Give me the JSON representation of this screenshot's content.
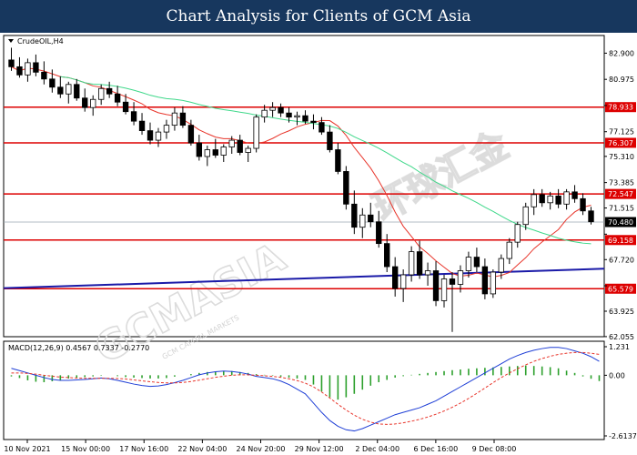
{
  "header": {
    "title": "Chart Analysis for Clients of GCM Asia"
  },
  "watermark": {
    "brand": "GCMASIA",
    "chinese": "环球汇金",
    "tagline": "GCM CAPITAL MARKETS"
  },
  "colors": {
    "background": "#ffffff",
    "header_bg": "#17375e",
    "bull_candle": "#ffffff",
    "bear_candle": "#000000",
    "fast_ma": "#e8352b",
    "slow_ma": "#3fd88a",
    "trendline": "#1a1aa8",
    "hline": "#dd0000",
    "macd_hist": "#2ca02c",
    "macd_line": "#1f3fd6",
    "macd_signal": "#e8352b",
    "price_tag": "#000000"
  },
  "chart_data": [
    {
      "type": "candlestick",
      "symbol_label": "CrudeOIL,H4",
      "ylim": [
        62.05,
        84.2
      ],
      "y_ticks": [
        "82.900",
        "80.975",
        "79.050",
        "77.125",
        "75.310",
        "73.385",
        "71.515",
        "69.590",
        "67.720",
        "65.795",
        "63.925",
        "62.055"
      ],
      "x_ticks": [
        "10 Nov 2021",
        "15 Nov 00:00",
        "17 Nov 16:00",
        "22 Nov 04:00",
        "24 Nov 20:00",
        "29 Nov 12:00",
        "2 Dec 04:00",
        "6 Dec 16:00",
        "9 Dec 08:00"
      ],
      "current_price": "70.480",
      "horizontal_levels": [
        "78.933",
        "76.307",
        "72.547",
        "69.158",
        "65.579"
      ],
      "candles": [
        [
          82.4,
          83.3,
          81.6,
          81.9
        ],
        [
          81.9,
          82.6,
          81.1,
          81.3
        ],
        [
          81.3,
          82.5,
          80.8,
          82.2
        ],
        [
          82.2,
          82.8,
          81.2,
          81.5
        ],
        [
          81.5,
          82.3,
          80.6,
          81.0
        ],
        [
          81.0,
          81.7,
          80.0,
          80.4
        ],
        [
          80.4,
          81.2,
          79.6,
          79.9
        ],
        [
          79.9,
          80.8,
          79.2,
          80.6
        ],
        [
          80.6,
          81.0,
          79.4,
          79.6
        ],
        [
          79.6,
          80.3,
          78.6,
          78.9
        ],
        [
          78.9,
          79.8,
          78.3,
          79.5
        ],
        [
          79.5,
          80.6,
          79.1,
          80.3
        ],
        [
          80.3,
          80.8,
          79.6,
          79.9
        ],
        [
          79.9,
          80.5,
          79.0,
          79.3
        ],
        [
          79.3,
          79.9,
          78.4,
          78.6
        ],
        [
          78.6,
          79.3,
          77.6,
          77.9
        ],
        [
          77.9,
          78.5,
          76.9,
          77.2
        ],
        [
          77.2,
          77.8,
          76.2,
          76.5
        ],
        [
          76.5,
          77.4,
          76.0,
          77.1
        ],
        [
          77.1,
          78.0,
          76.6,
          77.6
        ],
        [
          77.6,
          78.9,
          77.2,
          78.5
        ],
        [
          78.5,
          79.0,
          77.4,
          77.6
        ],
        [
          77.6,
          78.0,
          76.1,
          76.3
        ],
        [
          76.3,
          76.9,
          75.0,
          75.3
        ],
        [
          75.3,
          76.1,
          74.6,
          75.8
        ],
        [
          75.8,
          76.6,
          75.2,
          75.4
        ],
        [
          75.4,
          76.2,
          74.9,
          76.0
        ],
        [
          76.0,
          76.8,
          75.5,
          76.5
        ],
        [
          76.5,
          76.9,
          75.4,
          75.6
        ],
        [
          75.6,
          76.1,
          74.9,
          75.9
        ],
        [
          75.9,
          78.4,
          75.6,
          78.2
        ],
        [
          78.2,
          79.1,
          77.8,
          78.7
        ],
        [
          78.7,
          79.3,
          78.2,
          78.9
        ],
        [
          78.9,
          79.2,
          78.2,
          78.5
        ],
        [
          78.5,
          78.9,
          77.8,
          78.2
        ],
        [
          78.2,
          78.6,
          77.6,
          78.3
        ],
        [
          78.3,
          78.7,
          77.7,
          77.9
        ],
        [
          77.9,
          78.4,
          77.3,
          77.8
        ],
        [
          77.8,
          78.2,
          76.9,
          77.1
        ],
        [
          77.1,
          77.6,
          75.6,
          75.8
        ],
        [
          75.8,
          76.3,
          74.0,
          74.2
        ],
        [
          74.2,
          74.6,
          71.4,
          71.8
        ],
        [
          71.8,
          72.8,
          69.6,
          70.1
        ],
        [
          70.1,
          71.5,
          69.3,
          71.0
        ],
        [
          71.0,
          71.9,
          70.1,
          70.5
        ],
        [
          70.5,
          71.3,
          68.6,
          68.9
        ],
        [
          68.9,
          69.6,
          66.8,
          67.2
        ],
        [
          67.2,
          67.9,
          65.0,
          65.6
        ],
        [
          65.6,
          67.0,
          64.6,
          66.6
        ],
        [
          66.6,
          68.7,
          66.1,
          68.3
        ],
        [
          68.3,
          69.1,
          66.3,
          66.6
        ],
        [
          66.6,
          67.5,
          65.8,
          66.9
        ],
        [
          66.9,
          67.6,
          64.3,
          64.7
        ],
        [
          64.7,
          66.6,
          64.2,
          66.3
        ],
        [
          66.3,
          66.8,
          62.4,
          65.9
        ],
        [
          65.9,
          67.3,
          65.3,
          66.9
        ],
        [
          66.9,
          68.3,
          66.4,
          67.9
        ],
        [
          67.9,
          68.6,
          66.8,
          67.2
        ],
        [
          67.2,
          67.8,
          64.8,
          65.2
        ],
        [
          65.2,
          67.0,
          64.9,
          66.8
        ],
        [
          66.8,
          68.1,
          66.3,
          67.8
        ],
        [
          67.8,
          69.3,
          67.4,
          69.0
        ],
        [
          69.0,
          70.5,
          68.6,
          70.3
        ],
        [
          70.3,
          71.9,
          69.9,
          71.6
        ],
        [
          71.6,
          72.9,
          71.0,
          72.5
        ],
        [
          72.5,
          72.9,
          71.6,
          71.9
        ],
        [
          71.9,
          72.7,
          71.4,
          72.4
        ],
        [
          72.4,
          72.9,
          71.5,
          71.8
        ],
        [
          71.8,
          72.9,
          71.4,
          72.7
        ],
        [
          72.7,
          73.2,
          71.9,
          72.2
        ],
        [
          72.2,
          72.6,
          71.0,
          71.3
        ],
        [
          71.3,
          71.6,
          70.3,
          70.5
        ]
      ]
    },
    {
      "type": "macd",
      "label": "MACD(12,26,9) 0.4567 0.7337 -0.2770",
      "y_ticks": [
        "1.231",
        "0.00",
        "-2.6137"
      ],
      "ylim": [
        -2.6137,
        1.231
      ],
      "histogram": [
        -0.05,
        -0.12,
        -0.22,
        -0.28,
        -0.3,
        -0.26,
        -0.2,
        -0.14,
        -0.1,
        -0.08,
        -0.05,
        -0.02,
        0.0,
        -0.04,
        -0.08,
        -0.1,
        -0.12,
        -0.14,
        -0.14,
        -0.12,
        -0.06,
        0.0,
        0.05,
        0.1,
        0.14,
        0.17,
        0.19,
        0.18,
        0.14,
        0.1,
        0.05,
        0.02,
        -0.02,
        -0.06,
        -0.1,
        -0.14,
        -0.2,
        -0.4,
        -0.7,
        -0.95,
        -1.05,
        -0.95,
        -0.8,
        -0.62,
        -0.45,
        -0.3,
        -0.2,
        -0.1,
        -0.04,
        0.02,
        0.06,
        0.1,
        0.14,
        0.18,
        0.22,
        0.25,
        0.28,
        0.3,
        0.32,
        0.34,
        0.36,
        0.38,
        0.4,
        0.42,
        0.4,
        0.38,
        0.35,
        0.3,
        0.2,
        0.1,
        -0.05,
        -0.15,
        -0.25
      ],
      "macd_line": [
        0.3,
        0.2,
        0.1,
        0.0,
        -0.1,
        -0.18,
        -0.22,
        -0.22,
        -0.2,
        -0.18,
        -0.15,
        -0.12,
        -0.15,
        -0.22,
        -0.3,
        -0.38,
        -0.44,
        -0.48,
        -0.46,
        -0.4,
        -0.32,
        -0.22,
        -0.1,
        0.02,
        0.1,
        0.15,
        0.18,
        0.16,
        0.12,
        0.05,
        -0.05,
        -0.1,
        -0.15,
        -0.25,
        -0.4,
        -0.6,
        -0.8,
        -1.2,
        -1.6,
        -1.95,
        -2.2,
        -2.35,
        -2.4,
        -2.3,
        -2.15,
        -2.0,
        -1.85,
        -1.7,
        -1.6,
        -1.5,
        -1.4,
        -1.25,
        -1.1,
        -0.9,
        -0.7,
        -0.5,
        -0.3,
        -0.1,
        0.1,
        0.3,
        0.5,
        0.7,
        0.85,
        0.98,
        1.08,
        1.15,
        1.2,
        1.2,
        1.15,
        1.05,
        0.95,
        0.8,
        0.6
      ],
      "signal_line": [
        0.1,
        0.1,
        0.08,
        0.05,
        0.0,
        -0.04,
        -0.08,
        -0.1,
        -0.12,
        -0.13,
        -0.13,
        -0.13,
        -0.13,
        -0.14,
        -0.16,
        -0.2,
        -0.24,
        -0.28,
        -0.31,
        -0.33,
        -0.33,
        -0.31,
        -0.27,
        -0.21,
        -0.15,
        -0.09,
        -0.04,
        0.0,
        0.02,
        0.02,
        0.0,
        -0.02,
        -0.05,
        -0.09,
        -0.15,
        -0.23,
        -0.34,
        -0.5,
        -0.72,
        -0.98,
        -1.25,
        -1.5,
        -1.72,
        -1.9,
        -2.02,
        -2.1,
        -2.12,
        -2.1,
        -2.05,
        -1.98,
        -1.9,
        -1.8,
        -1.68,
        -1.54,
        -1.38,
        -1.2,
        -1.0,
        -0.78,
        -0.55,
        -0.32,
        -0.1,
        0.1,
        0.28,
        0.45,
        0.6,
        0.72,
        0.82,
        0.9,
        0.95,
        0.98,
        0.98,
        0.95,
        0.9
      ]
    }
  ]
}
